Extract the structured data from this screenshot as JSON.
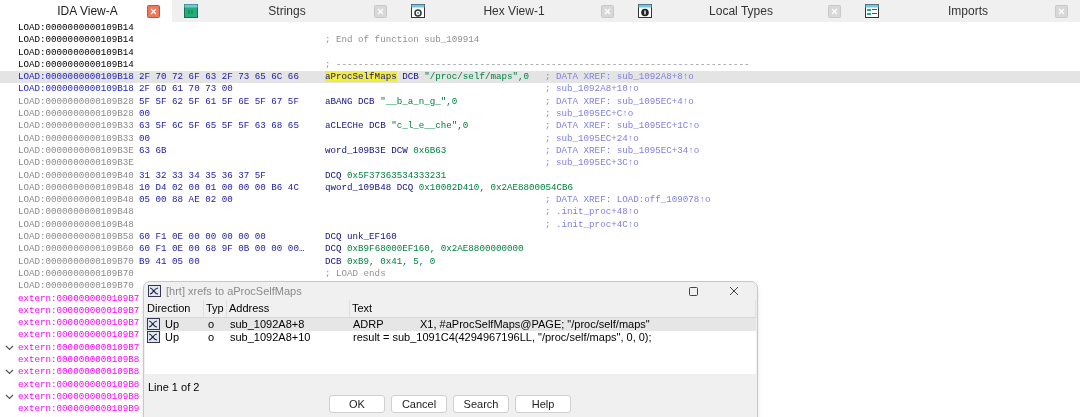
{
  "tabs": [
    {
      "label": "IDA View-A",
      "selected": true
    },
    {
      "label": "Strings",
      "selected": false
    },
    {
      "label": "Hex View-1",
      "selected": false
    },
    {
      "label": "Local Types",
      "selected": false
    },
    {
      "label": "Imports",
      "selected": false
    }
  ],
  "listing": [
    {
      "address": "LOAD:0000000000109B14",
      "kind": "normal",
      "selected": false,
      "collapsible": false
    },
    {
      "address": "LOAD:0000000000109B14",
      "kind": "normal",
      "selected": false,
      "collapsible": false,
      "code": [
        {
          "text": "; End of function sub_109914",
          "kind": "gray"
        }
      ]
    },
    {
      "address": "LOAD:0000000000109B14",
      "kind": "normal",
      "selected": false,
      "collapsible": false
    },
    {
      "address": "LOAD:0000000000109B14",
      "kind": "normal",
      "selected": false,
      "collapsible": false,
      "code": [
        {
          "text": "; ---------------------------------------------------------------------------",
          "kind": "gray"
        }
      ]
    },
    {
      "address": "LOAD:0000000000109B18",
      "kind": "current",
      "selected": true,
      "collapsible": false,
      "bytes": "2F 70 72 6F 63 2F 73 65 6C 66",
      "code": [
        {
          "text": "aProcSelfMaps",
          "kind": "highlight"
        },
        {
          "text": " DCB ",
          "kind": "plain"
        },
        {
          "text": "\"/proc/self/maps\",0",
          "kind": "value"
        }
      ],
      "comment": "; DATA XREF: sub_1092A8+8↑o"
    },
    {
      "address": "LOAD:0000000000109B18",
      "kind": "current",
      "selected": false,
      "collapsible": false,
      "bytes": "2F 6D 61 70 73 00",
      "comment": "; sub_1092A8+10↑o"
    },
    {
      "address": "LOAD:0000000000109B28",
      "kind": "dim",
      "selected": false,
      "collapsible": false,
      "bytes": "5F 5F 62 5F 61 5F 6E 5F 67 5F",
      "code": [
        {
          "text": "aBANG DCB ",
          "kind": "plain"
        },
        {
          "text": "\"__b_a_n_g_\",0",
          "kind": "value"
        }
      ],
      "comment": "; DATA XREF: sub_1095EC+4↑o"
    },
    {
      "address": "LOAD:0000000000109B28",
      "kind": "dim",
      "selected": false,
      "collapsible": false,
      "bytes": "00",
      "comment": "; sub_1095EC+C↑o"
    },
    {
      "address": "LOAD:0000000000109B33",
      "kind": "dim",
      "selected": false,
      "collapsible": false,
      "bytes": "63 5F 6C 5F 65 5F 5F 63 68 65",
      "code": [
        {
          "text": "aCLECHe DCB ",
          "kind": "plain"
        },
        {
          "text": "\"c_l_e__che\",0",
          "kind": "value"
        }
      ],
      "comment": "; DATA XREF: sub_1095EC+1C↑o"
    },
    {
      "address": "LOAD:0000000000109B33",
      "kind": "dim",
      "selected": false,
      "collapsible": false,
      "bytes": "00",
      "comment": "; sub_1095EC+24↑o"
    },
    {
      "address": "LOAD:0000000000109B3E",
      "kind": "dim",
      "selected": false,
      "collapsible": false,
      "bytes": "63 6B",
      "code": [
        {
          "text": "word_109B3E DCW ",
          "kind": "plain"
        },
        {
          "text": "0x6B63",
          "kind": "value"
        }
      ],
      "comment": "; DATA XREF: sub_1095EC+34↑o"
    },
    {
      "address": "LOAD:0000000000109B3E",
      "kind": "dim",
      "selected": false,
      "collapsible": false,
      "comment": "; sub_1095EC+3C↑o"
    },
    {
      "address": "LOAD:0000000000109B40",
      "kind": "dim",
      "selected": false,
      "collapsible": false,
      "bytes": "31 32 33 34 35 36 37 5F",
      "code": [
        {
          "text": "DCQ ",
          "kind": "plain"
        },
        {
          "text": "0x5F37363534333231",
          "kind": "value"
        }
      ]
    },
    {
      "address": "LOAD:0000000000109B48",
      "kind": "dim",
      "selected": false,
      "collapsible": false,
      "bytes": "10 D4 02 00 01 00 00 00 B6 4C",
      "code": [
        {
          "text": "qword_109B48 DCQ ",
          "kind": "plain"
        },
        {
          "text": "0x10002D410, 0x2AE8800054CB6",
          "kind": "value"
        }
      ]
    },
    {
      "address": "LOAD:0000000000109B48",
      "kind": "dim",
      "selected": false,
      "collapsible": false,
      "bytes": "05 00 88 AE 02 00",
      "comment": "; DATA XREF: LOAD:off_109078↑o"
    },
    {
      "address": "LOAD:0000000000109B48",
      "kind": "dim",
      "selected": false,
      "collapsible": false,
      "comment": "; .init_proc+48↑o"
    },
    {
      "address": "LOAD:0000000000109B48",
      "kind": "dim",
      "selected": false,
      "collapsible": false,
      "comment": "; .init_proc+4C↑o"
    },
    {
      "address": "LOAD:0000000000109B58",
      "kind": "dim",
      "selected": false,
      "collapsible": false,
      "bytes": "60 F1 0E 00 00 00 00 00",
      "code": [
        {
          "text": "DCQ unk_EF160",
          "kind": "plain"
        }
      ]
    },
    {
      "address": "LOAD:0000000000109B60",
      "kind": "dim",
      "selected": false,
      "collapsible": false,
      "bytes": "60 F1 0E 00 68 9F 0B 00 00 00…",
      "code": [
        {
          "text": "DCQ ",
          "kind": "plain"
        },
        {
          "text": "0xB9F68000EF160, 0x2AE8800000000",
          "kind": "value"
        }
      ]
    },
    {
      "address": "LOAD:0000000000109B70",
      "kind": "dim",
      "selected": false,
      "collapsible": false,
      "bytes": "B9 41 05 00",
      "code": [
        {
          "text": "DCB ",
          "kind": "plain"
        },
        {
          "text": "0xB9, 0x41, 5, 0",
          "kind": "value"
        }
      ]
    },
    {
      "address": "LOAD:0000000000109B70",
      "kind": "dim",
      "selected": false,
      "collapsible": false,
      "code": [
        {
          "text": "; LOAD ends",
          "kind": "gray"
        }
      ]
    },
    {
      "address": "LOAD:0000000000109B70",
      "kind": "dim",
      "selected": false,
      "collapsible": false
    },
    {
      "address": "extern:0000000000109B7",
      "kind": "extern",
      "selected": false,
      "collapsible": false
    },
    {
      "address": "extern:0000000000109B7",
      "kind": "extern",
      "selected": false,
      "collapsible": false
    },
    {
      "address": "extern:0000000000109B7",
      "kind": "extern",
      "selected": false,
      "collapsible": false
    },
    {
      "address": "extern:0000000000109B7",
      "kind": "extern",
      "selected": false,
      "collapsible": false
    },
    {
      "address": "extern:0000000000109B7",
      "kind": "extern",
      "selected": false,
      "collapsible": true
    },
    {
      "address": "extern:0000000000109B8",
      "kind": "extern",
      "selected": false,
      "collapsible": false
    },
    {
      "address": "extern:0000000000109B8",
      "kind": "extern",
      "selected": false,
      "collapsible": true
    },
    {
      "address": "extern:0000000000109B8",
      "kind": "extern",
      "selected": false,
      "collapsible": false
    },
    {
      "address": "extern:0000000000109B8",
      "kind": "extern",
      "selected": false,
      "collapsible": true
    },
    {
      "address": "extern:0000000000109B9",
      "kind": "extern",
      "selected": false,
      "collapsible": false
    }
  ],
  "dialog": {
    "title": "[hrt] xrefs to aProcSelfMaps",
    "columns": [
      "Direction",
      "Typ",
      "Address",
      "Text"
    ],
    "rows": [
      {
        "direction": "Up",
        "type": "o",
        "address": "sub_1092A8+8",
        "text": "ADRP            X1, #aProcSelfMaps@PAGE; \"/proc/self/maps\"",
        "selected": true
      },
      {
        "direction": "Up",
        "type": "o",
        "address": "sub_1092A8+10",
        "text": "result = sub_1091C4(4294967196LL, \"/proc/self/maps\", 0, 0);",
        "selected": false
      }
    ],
    "status": "Line 1 of 2",
    "buttons": [
      "OK",
      "Cancel",
      "Search",
      "Help"
    ]
  }
}
